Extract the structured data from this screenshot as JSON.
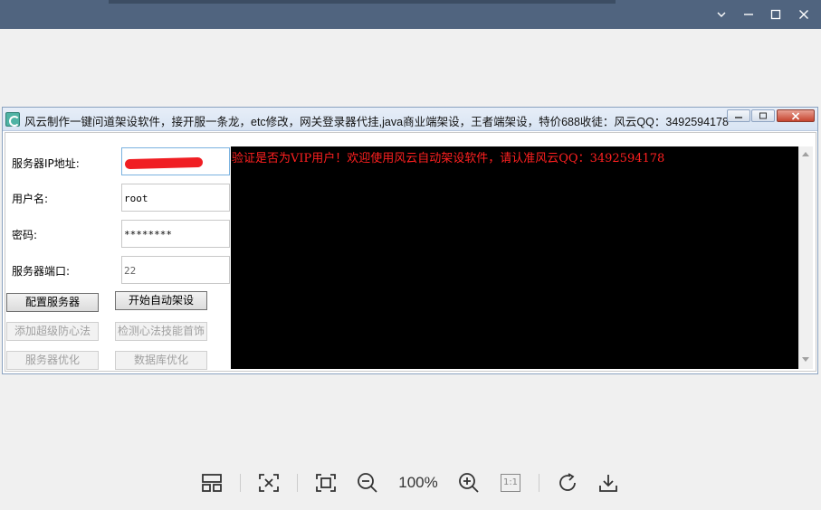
{
  "viewer": {
    "window_controls": {
      "minimize": "minimize-icon",
      "maximize": "maximize-icon",
      "close": "close-icon"
    },
    "toolbar": {
      "zoom_level": "100%",
      "icons": [
        "layout-icon",
        "fit-screen-icon",
        "fullscreen-icon",
        "zoom-out-icon",
        "zoom-in-icon",
        "actual-size-icon",
        "rotate-icon",
        "download-icon"
      ],
      "actual_size_label": "1:1"
    }
  },
  "app": {
    "title": "风云制作一键问道架设软件，接开服一条龙，etc修改，网关登录器代挂,java商业端架设，王者端架设，特价688收徒：风云QQ：3492594178",
    "form": {
      "ip_label": "服务器IP地址:",
      "ip_value": "",
      "username_label": "用户名:",
      "username_value": "root",
      "password_label": "密码:",
      "password_value": "********",
      "port_label": "服务器端口:",
      "port_value": "22"
    },
    "buttons": {
      "configure": "配置服务器",
      "auto_setup": "开始自动架设",
      "add_protection": "添加超级防心法",
      "check_skills": "检测心法技能首饰",
      "optimize_server": "服务器优化",
      "optimize_db": "数据库优化"
    },
    "console": {
      "message": "验证是否为VIP用户！欢迎使用风云自动架设软件，请认准风云QQ：3492594178",
      "text_color": "#ff2020",
      "background": "#000000"
    }
  }
}
